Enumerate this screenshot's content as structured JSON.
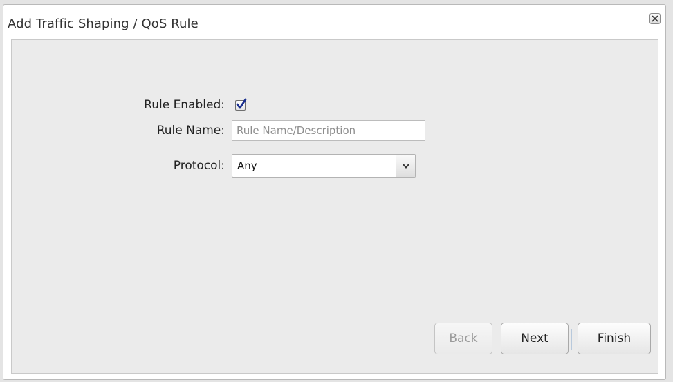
{
  "dialog": {
    "title": "Add Traffic Shaping / QoS Rule",
    "close_icon": "close-icon"
  },
  "form": {
    "rule_enabled": {
      "label": "Rule Enabled:",
      "checked": true
    },
    "rule_name": {
      "label": "Rule Name:",
      "value": "",
      "placeholder": "Rule Name/Description"
    },
    "protocol": {
      "label": "Protocol:",
      "selected": "Any"
    }
  },
  "buttons": {
    "back": "Back",
    "next": "Next",
    "finish": "Finish"
  },
  "colors": {
    "checkbox_check": "#1a2f8f",
    "body_background": "#ebebeb"
  }
}
